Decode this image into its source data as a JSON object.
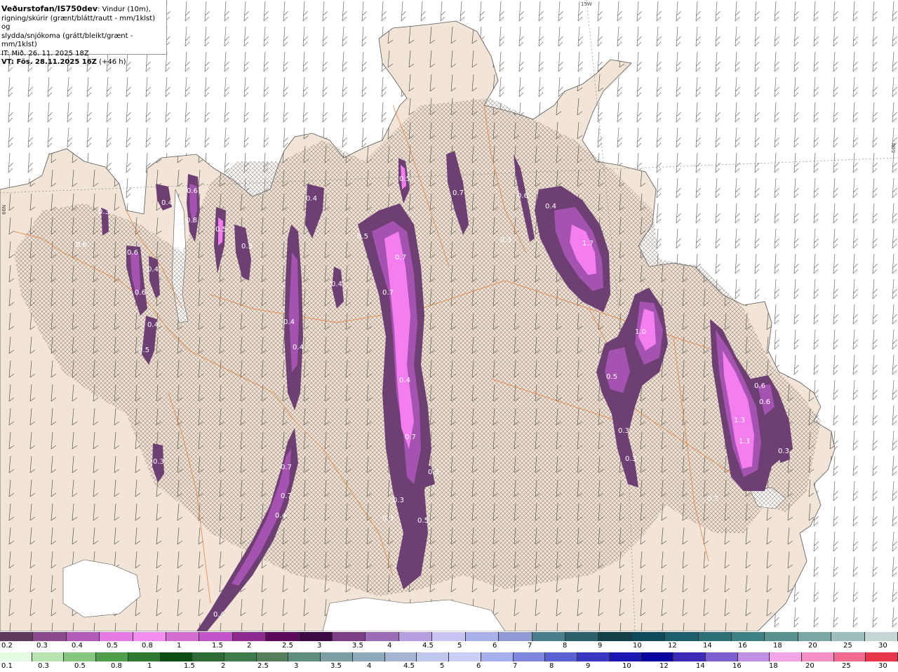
{
  "header": {
    "title": "Veðurstofan/IS750dev",
    "title_suffix": ": Vindur (10m),",
    "line2": "rigning/skúrir (grænt/blátt/rautt - mm/1klst) og",
    "line3": "slydda/snjókoma (grátt/bleikt/grænt - mm/1klst)",
    "init_time": "IT: Mið. 26. 11. 2025 18Z",
    "valid_time": "VT: Fös. 28.11.2025 16Z",
    "lead": "(+46 h)"
  },
  "grid_labels": {
    "top": "15W",
    "right": "66N",
    "left": "66N"
  },
  "colors": {
    "land": "#f2e4d6",
    "sea": "#ffffff",
    "roads": "#e8823a",
    "precip_dark": "#6e3f72",
    "precip_mid": "#a553b0",
    "precip_light": "#f47df0"
  },
  "precip_labels": [
    "0.5",
    "0.4",
    "0.3",
    "0.4",
    "0.6",
    "0.8",
    "0.5",
    "0.6",
    "0.4",
    "0.6",
    "0.6",
    "0.4",
    "0.5",
    "0.3",
    "0.4",
    "0.3",
    "0.4",
    "0.4",
    "0.5",
    "0.7",
    "0.7",
    "0.7",
    "0.4",
    "0.6",
    "0.4",
    "0.7",
    "0.7",
    "0.3",
    "0.7",
    "0.3",
    "0.3",
    "0.5",
    "0.3",
    "0.4",
    "1.7",
    "1.0",
    "0.5",
    "0.3",
    "0.3",
    "0.6",
    "0.6",
    "1.3",
    "1.3",
    "0.3",
    "0.3",
    "0.4"
  ],
  "legend_snow": {
    "colors": [
      "#5e3a5e",
      "#8a4a8c",
      "#b35bb8",
      "#e87ae3",
      "#f18ef0",
      "#d46fd2",
      "#c253c8",
      "#8e2b8e",
      "#5b0a5e",
      "#3d0a45",
      "#7c3f85",
      "#9b6cb8",
      "#b59fe0",
      "#c9c5f2",
      "#aab0ea",
      "#8f99d4",
      "#4c7d8a",
      "#2c5f6a",
      "#123f48",
      "#0e4a58",
      "#1c5e6a",
      "#2c7075",
      "#3f8084",
      "#5b9290",
      "#7aa6a6",
      "#9fbdbc",
      "#c6d5d6"
    ],
    "labels": [
      "0.2",
      "0.3",
      "0.4",
      "0.5",
      "0.8",
      "1",
      "1.5",
      "2",
      "2.5",
      "3",
      "3.5",
      "4",
      "4.5",
      "5",
      "6",
      "7",
      "8",
      "9",
      "10",
      "12",
      "14",
      "16",
      "18",
      "20",
      "25",
      "30"
    ]
  },
  "legend_rain": {
    "colors": [
      "#e6fbe3",
      "#b8e5b0",
      "#86c57e",
      "#4e9e4e",
      "#2e7a30",
      "#0d4f12",
      "#2d6a34",
      "#3e7a4a",
      "#567f5c",
      "#5f8d7e",
      "#7a9ea2",
      "#8eaabb",
      "#a6b6d2",
      "#bfc7ec",
      "#c9cff5",
      "#a7b0ee",
      "#7e86e0",
      "#5a5fd2",
      "#3a37c2",
      "#1c17b2",
      "#0a049e",
      "#3c2ab8",
      "#7b5ed0",
      "#c08fe4",
      "#f2a4e6",
      "#f58fc4",
      "#f06a90",
      "#e8374a"
    ],
    "labels": [
      "0.1",
      "0.3",
      "0.5",
      "0.8",
      "1",
      "1.5",
      "2",
      "2.5",
      "3",
      "3.5",
      "4",
      "4.5",
      "5",
      "6",
      "7",
      "8",
      "9",
      "10",
      "12",
      "14",
      "16",
      "18",
      "20",
      "25",
      "30"
    ]
  }
}
